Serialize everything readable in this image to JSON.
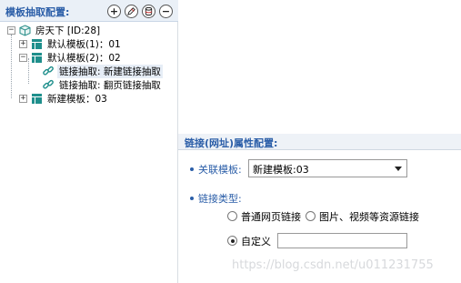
{
  "left_panel": {
    "title": "模板抽取配置:",
    "toolbar": [
      {
        "icon": "plus-icon",
        "glyph": "+"
      },
      {
        "icon": "edit-icon",
        "glyph": ""
      },
      {
        "icon": "database-icon",
        "glyph": ""
      },
      {
        "icon": "minus-icon",
        "glyph": "−"
      }
    ],
    "tree": {
      "root": {
        "label": "房天下 [ID:28]",
        "toggle": "−"
      },
      "templates": [
        {
          "label": "默认模板(1)：01",
          "toggle": "+"
        },
        {
          "label": "默认模板(2)：02",
          "toggle": "−",
          "children": [
            {
              "label": "链接抽取: 新建链接抽取",
              "selected": true
            },
            {
              "label": "链接抽取: 翻页链接抽取",
              "selected": false
            }
          ]
        },
        {
          "label": "新建模板：03",
          "toggle": "+"
        }
      ]
    }
  },
  "form": {
    "section_title": "链接(网址)属性配置:",
    "template_label": "关联模板:",
    "template_value": "新建模板:03",
    "link_type_label": "链接类型:",
    "options": [
      {
        "label": "普通网页链接",
        "checked": false
      },
      {
        "label": "图片、视频等资源链接",
        "checked": false
      },
      {
        "label": "自定义",
        "checked": true
      }
    ],
    "custom_value": ""
  },
  "watermark": "https://blog.csdn.net/u011231755",
  "colors": {
    "accent": "#2b5ea8",
    "header_bg": "#eaf0f7",
    "template_icon": "#1f8f8c"
  }
}
